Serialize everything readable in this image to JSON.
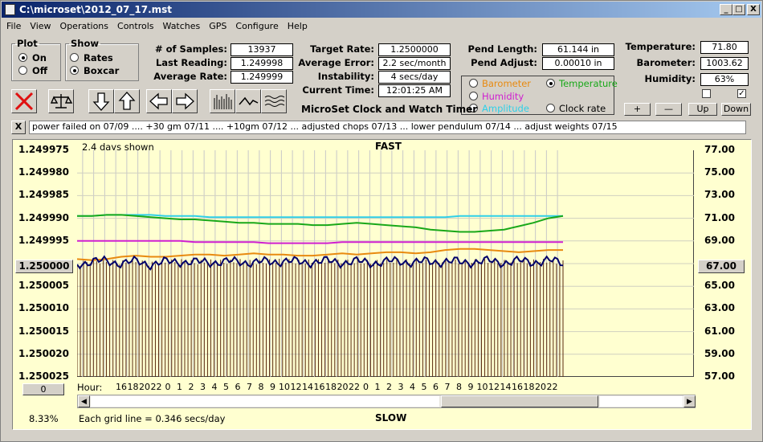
{
  "window": {
    "title": "C:\\microset\\2012_07_17.mst",
    "min": "_",
    "max": "□",
    "close": "X"
  },
  "menu": [
    "File",
    "View",
    "Operations",
    "Controls",
    "Watches",
    "GPS",
    "Configure",
    "Help"
  ],
  "plot_group": {
    "title": "Plot",
    "on": "On",
    "off": "Off"
  },
  "show_group": {
    "title": "Show",
    "rates": "Rates",
    "boxcar": "Boxcar"
  },
  "stats": {
    "samples_label": "# of Samples:",
    "samples": "13937",
    "last_label": "Last Reading:",
    "last": "1.249998",
    "avg_label": "Average Rate:",
    "avg": "1.249999",
    "target_label": "Target Rate:",
    "target": "1.2500000",
    "avgerr_label": "Average Error:",
    "avgerr": "2.2 sec/month",
    "instab_label": "Instability:",
    "instab": "4 secs/day",
    "curtime_label": "Current Time:",
    "curtime": "12:01:25 AM",
    "pendlen_label": "Pend Length:",
    "pendlen": "61.144 in",
    "pendadj_label": "Pend Adjust:",
    "pendadj": "0.00010 in",
    "temp_label": "Temperature:",
    "temp": "71.80",
    "baro_label": "Barometer:",
    "baro": "1003.62",
    "hum_label": "Humidity:",
    "hum": "63%"
  },
  "app_name": "MicroSet Clock and Watch Timer",
  "sensor_select": {
    "barometer": "Barometer",
    "temperature": "Temperature",
    "humidity": "Humidity",
    "amplitude": "Amplitude",
    "clock_rate": "Clock rate"
  },
  "sensor_buttons": {
    "plus": "+",
    "minus": "—",
    "up": "Up",
    "down": "Down"
  },
  "notes_close": "X",
  "notes": "power failed on 07/09 ....  +30 gm 07/11  ....  +10gm 07/12  ...  adjusted chops 07/13  ...  lower pendulum 07/14  ...  adjust weights 07/15",
  "chart_labels": {
    "days_shown": "2.4 days shown",
    "fast": "FAST",
    "slow": "SLOW",
    "hour": "Hour:",
    "grid_note": "Each grid line = 0.346 secs/day",
    "percent": "8.33%",
    "left_box": "1.250000",
    "right_box": "67.00",
    "bottom_box": "0"
  },
  "colors": {
    "rate": "#00006a",
    "bars": "#5a2a10",
    "temperature": "#19a819",
    "amplitude": "#30d0e8",
    "humidity": "#d020d0",
    "barometer": "#e88a10",
    "plot_bg": "#ffffd0"
  },
  "chart_data": {
    "type": "line",
    "y_left_ticks": [
      "1.249975",
      "1.249980",
      "1.249985",
      "1.249990",
      "1.249995",
      "1.250000",
      "1.250005",
      "1.250010",
      "1.250015",
      "1.250020",
      "1.250025"
    ],
    "y_right_ticks": [
      "77.00",
      "75.00",
      "73.00",
      "71.00",
      "69.00",
      "67.00",
      "65.00",
      "63.00",
      "61.00",
      "59.00",
      "57.00"
    ],
    "x_ticks": [
      "16",
      "18",
      "20",
      "22",
      "0",
      "1",
      "2",
      "3",
      "4",
      "5",
      "6",
      "7",
      "8",
      "9",
      "10",
      "12",
      "14",
      "16",
      "18",
      "20",
      "22",
      "0",
      "1",
      "2",
      "3",
      "4",
      "5",
      "6",
      "7",
      "8",
      "9",
      "10",
      "12",
      "14",
      "16",
      "18",
      "20",
      "22"
    ],
    "series": [
      {
        "name": "Temperature",
        "values": [
          71.2,
          71.2,
          71.3,
          71.3,
          71.2,
          71.1,
          71.0,
          70.9,
          70.9,
          70.8,
          70.7,
          70.6,
          70.6,
          70.5,
          70.5,
          70.5,
          70.4,
          70.4,
          70.5,
          70.6,
          70.5,
          70.4,
          70.3,
          70.2,
          70.0,
          69.9,
          69.8,
          69.8,
          69.9,
          70.0,
          70.3,
          70.6,
          71.0,
          71.2
        ]
      },
      {
        "name": "Amplitude",
        "values": [
          71.2,
          71.2,
          71.3,
          71.3,
          71.3,
          71.3,
          71.2,
          71.2,
          71.2,
          71.1,
          71.1,
          71.1,
          71.1,
          71.1,
          71.1,
          71.1,
          71.1,
          71.1,
          71.1,
          71.1,
          71.1,
          71.1,
          71.1,
          71.1,
          71.1,
          71.1,
          71.2,
          71.2,
          71.2,
          71.2,
          71.2,
          71.2,
          71.2,
          71.2
        ]
      },
      {
        "name": "Humidity",
        "values": [
          69.0,
          69.0,
          69.0,
          69.0,
          69.0,
          69.0,
          69.0,
          69.0,
          68.9,
          68.9,
          68.9,
          68.9,
          68.9,
          68.8,
          68.8,
          68.8,
          68.8,
          68.8,
          68.9,
          68.9,
          68.9,
          68.9,
          68.9,
          68.9,
          68.9,
          68.9,
          68.9,
          68.9,
          68.9,
          68.9,
          68.9,
          68.9,
          68.9,
          68.9
        ]
      },
      {
        "name": "Barometer",
        "values": [
          67.4,
          67.3,
          67.4,
          67.6,
          67.7,
          67.6,
          67.6,
          67.7,
          67.8,
          67.8,
          67.7,
          67.8,
          67.9,
          67.8,
          67.8,
          67.7,
          67.7,
          67.8,
          67.9,
          67.8,
          67.9,
          68.0,
          68.0,
          67.9,
          68.0,
          68.2,
          68.3,
          68.3,
          68.2,
          68.1,
          68.0,
          68.1,
          68.2,
          68.2
        ]
      },
      {
        "name": "Rate",
        "values": [
          1.2500002,
          1.2499994,
          1.2499996,
          1.2499998,
          1.2499996,
          1.2500001,
          1.2499997,
          1.2499995,
          1.2499998,
          1.2499996,
          1.2499997,
          1.2499995,
          1.2499998,
          1.2499996,
          1.2499994,
          1.2499997,
          1.2499996,
          1.2499995,
          1.2499997,
          1.2499996,
          1.2499998,
          1.2499996,
          1.2499995,
          1.2499997,
          1.2499996,
          1.2499995,
          1.2499997,
          1.2499996,
          1.2499995,
          1.2499997,
          1.2499995,
          1.2499996,
          1.2499994,
          1.2499998
        ]
      }
    ],
    "ylim_left": [
      1.249975,
      1.250025
    ],
    "ylim_right": [
      57,
      77
    ],
    "grid": true
  }
}
